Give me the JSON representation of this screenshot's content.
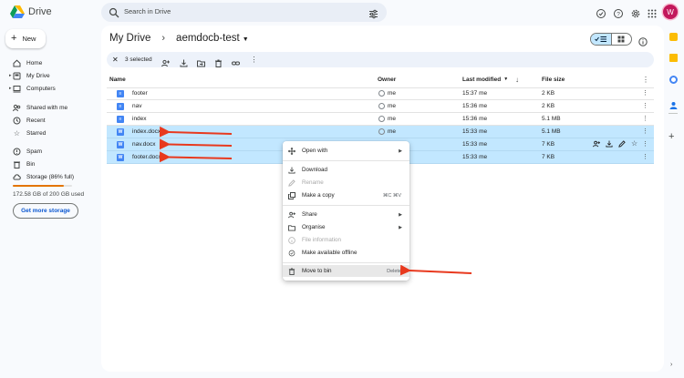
{
  "header": {
    "app_name": "Drive",
    "search_placeholder": "Search in Drive",
    "avatar_letter": "W"
  },
  "sidebar": {
    "new_label": "New",
    "items": [
      {
        "label": "Home",
        "icon": "home-icon"
      },
      {
        "label": "My Drive",
        "icon": "my-drive-icon"
      },
      {
        "label": "Computers",
        "icon": "computers-icon"
      },
      {
        "label": "Shared with me",
        "icon": "shared-icon"
      },
      {
        "label": "Recent",
        "icon": "recent-icon"
      },
      {
        "label": "Starred",
        "icon": "star-icon"
      },
      {
        "label": "Spam",
        "icon": "spam-icon"
      },
      {
        "label": "Bin",
        "icon": "bin-icon"
      },
      {
        "label": "Storage (86% full)",
        "icon": "cloud-icon"
      }
    ],
    "storage_fraction": 0.86,
    "storage_text": "172.58 GB of 200 GB used",
    "get_storage_label": "Get more storage"
  },
  "breadcrumb": {
    "root": "My Drive",
    "sep": "›",
    "current": "aemdocb-test"
  },
  "selection_bar": {
    "close": "✕",
    "count_label": "3 selected"
  },
  "table": {
    "columns": {
      "name": "Name",
      "owner": "Owner",
      "modified": "Last modified",
      "size": "File size"
    },
    "rows": [
      {
        "name": "footer",
        "owner": "me",
        "modified": "15:37 me",
        "size": "2 KB",
        "type": "doc",
        "selected": false
      },
      {
        "name": "nav",
        "owner": "me",
        "modified": "15:36 me",
        "size": "2 KB",
        "type": "doc",
        "selected": false
      },
      {
        "name": "index",
        "owner": "me",
        "modified": "15:36 me",
        "size": "5.1 MB",
        "type": "doc",
        "selected": false
      },
      {
        "name": "index.docx",
        "owner": "me",
        "modified": "15:33 me",
        "size": "5.1 MB",
        "type": "word",
        "selected": true
      },
      {
        "name": "nav.docx",
        "owner": "",
        "modified": "15:33 me",
        "size": "7 KB",
        "type": "word",
        "selected": true
      },
      {
        "name": "footer.docx",
        "owner": "",
        "modified": "15:33 me",
        "size": "7 KB",
        "type": "word",
        "selected": true
      }
    ]
  },
  "context_menu": {
    "open_with": "Open with",
    "download": "Download",
    "rename": "Rename",
    "make_copy": "Make a copy",
    "make_copy_shortcut": "⌘C ⌘V",
    "share": "Share",
    "organise": "Organise",
    "file_info": "File information",
    "offline": "Make available offline",
    "move_to_bin": "Move to bin",
    "move_to_bin_shortcut": "Delete"
  },
  "colors": {
    "accent": "#0b57d0",
    "selected_row": "#c2e7ff",
    "annotation_arrow": "#e8391e",
    "storage_warning": "#e37400"
  }
}
